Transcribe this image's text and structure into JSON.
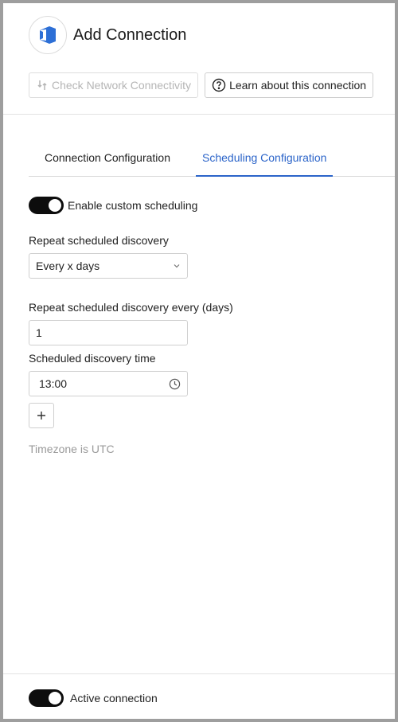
{
  "header": {
    "title": "Add Connection",
    "logo_icon": "azure-devops-logo-icon",
    "brand_color": "#2d6fd6"
  },
  "actions": {
    "check_network": {
      "label": "Check Network Connectivity",
      "icon": "network-check-icon",
      "disabled": true
    },
    "learn": {
      "label": "Learn about this connection",
      "icon": "help-circle-icon"
    }
  },
  "tabs": [
    {
      "label": "Connection Configuration",
      "active": false
    },
    {
      "label": "Scheduling Configuration",
      "active": true
    }
  ],
  "scheduling": {
    "custom_scheduling": {
      "label": "Enable custom scheduling",
      "enabled": true
    },
    "repeat": {
      "label": "Repeat scheduled discovery",
      "value": "Every x days"
    },
    "interval": {
      "label": "Repeat scheduled discovery every (days)",
      "value": "1"
    },
    "time": {
      "label": "Scheduled discovery time",
      "value": "13:00"
    },
    "timezone_note": "Timezone is UTC"
  },
  "footer": {
    "active_connection": {
      "label": "Active connection",
      "enabled": true
    }
  },
  "colors": {
    "accent": "#2b64c9",
    "toggle_on": "#0d0d0d"
  }
}
